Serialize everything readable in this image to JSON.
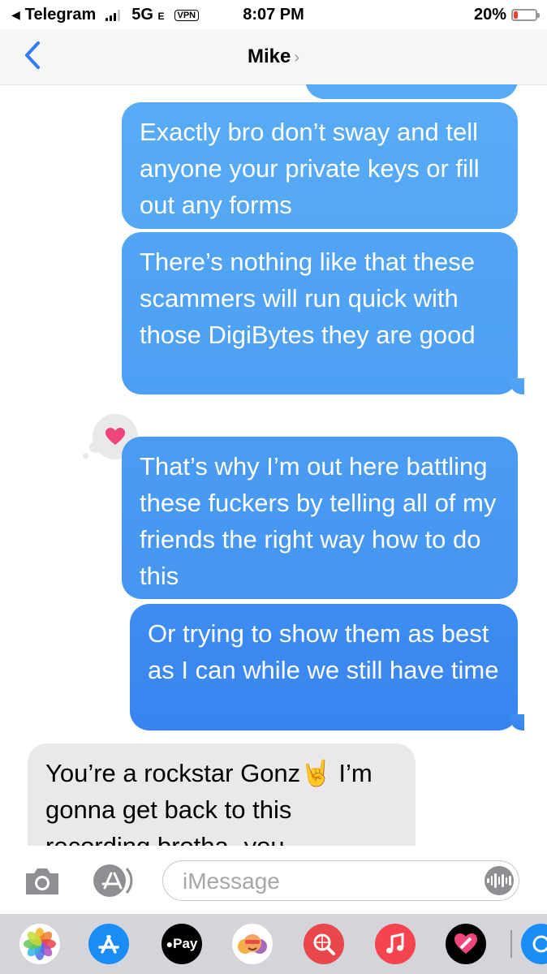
{
  "status_bar": {
    "back_app": "Telegram",
    "network": "5G",
    "network_suffix": "E",
    "vpn": "VPN",
    "time": "8:07 PM",
    "battery_percent": "20%",
    "battery_level": 0.2,
    "battery_color": "#ff3b30"
  },
  "nav": {
    "contact_name": "Mike",
    "chevron": "›",
    "accent": "#2f7df6"
  },
  "conversation": {
    "messages": [
      {
        "from": "me",
        "text": "Exactly bro don’t sway and tell anyone your private keys or fill out any forms"
      },
      {
        "from": "me",
        "text": "There’s nothing like that these scammers will run quick with those DigiBytes they are good"
      },
      {
        "from": "me",
        "text": "That’s why I’m out here battling these fuckers by telling all of my friends the right way how to do this",
        "tapback": "heart-icon"
      },
      {
        "from": "me",
        "text": "Or trying to show them as best as I can while we still have time"
      },
      {
        "from": "them",
        "text": "You’re a rockstar Gonz🤘 I’m gonna get back to this recording brotha- you"
      }
    ],
    "tapback_color": "#f0457a",
    "sent_gradient_top": "#5aacf5",
    "sent_gradient_bottom": "#2f79ef"
  },
  "input": {
    "placeholder": "iMessage"
  },
  "app_strip": {
    "apps": [
      "photos-icon",
      "app-store-icon",
      "apple-pay-icon",
      "memoji-icon",
      "web-search-icon",
      "music-icon",
      "heart-app-icon",
      "more-icon"
    ],
    "apple_pay_label": "Pay"
  }
}
